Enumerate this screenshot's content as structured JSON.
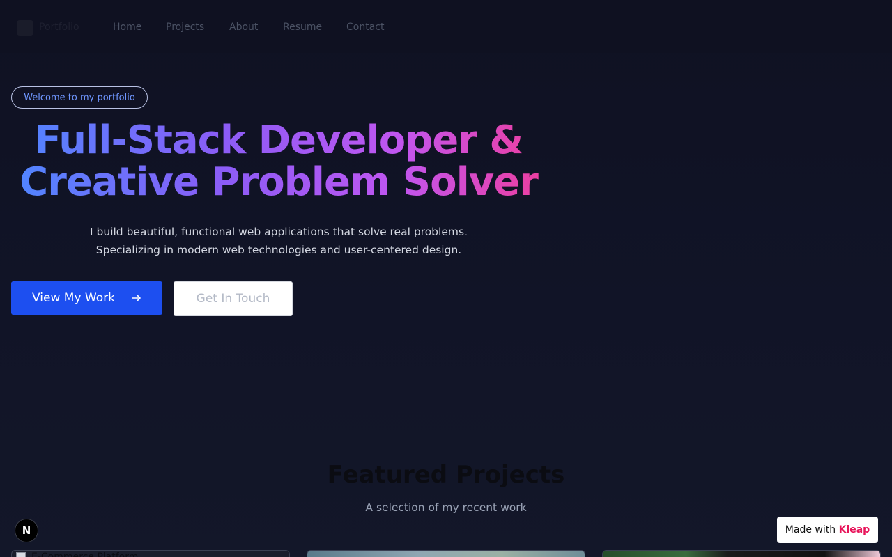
{
  "nav": {
    "logo_text": "Portfolio",
    "links": [
      "Home",
      "Projects",
      "About",
      "Resume",
      "Contact"
    ]
  },
  "hero": {
    "badge": "Welcome to my portfolio",
    "headline_line1": "Full-Stack Developer &",
    "headline_line2": "Creative Problem Solver",
    "subtext_line1": "I build beautiful, functional web applications that solve real problems.",
    "subtext_line2": "Specializing in modern web technologies and user-centered design.",
    "primary_button": "View My Work",
    "primary_button_icon": "arrow-right-icon",
    "secondary_button": "Get In Touch"
  },
  "featured": {
    "title": "Featured Projects",
    "subtitle": "A selection of my recent work",
    "cards": [
      {
        "alt": "E-Commerce Platform"
      },
      {
        "alt": ""
      },
      {
        "alt": ""
      }
    ]
  },
  "floating": {
    "n_badge": "N",
    "made_with_prefix": "Made with",
    "made_with_brand": "Kleap"
  },
  "colors": {
    "background": "#0f1120",
    "primary_button": "#1d4ff0",
    "badge_text": "#6f96ff",
    "gradient_start": "#4f86ff",
    "gradient_mid": "#8c5cf6",
    "gradient_end": "#ee3e9e",
    "brand_accent": "#e8145a"
  }
}
